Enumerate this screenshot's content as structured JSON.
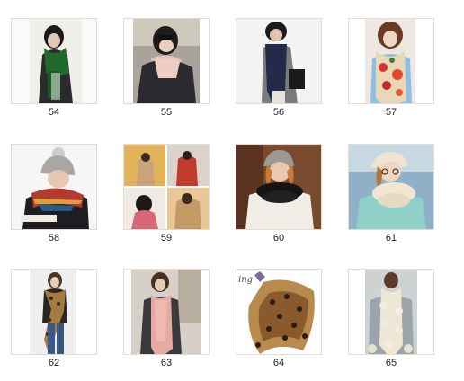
{
  "gallery": {
    "items": [
      {
        "number": "54",
        "image": "woman-green-scarf-photo"
      },
      {
        "number": "55",
        "image": "woman-pink-scarf-sunglasses-photo"
      },
      {
        "number": "56",
        "image": "woman-navy-scarf-photo"
      },
      {
        "number": "57",
        "image": "woman-floral-scarf-photo"
      },
      {
        "number": "58",
        "image": "woman-knit-hat-plaid-scarf-photo"
      },
      {
        "number": "59",
        "image": "scarf-collage-four-photos"
      },
      {
        "number": "60",
        "image": "woman-black-infinity-scarf-photo"
      },
      {
        "number": "61",
        "image": "woman-cream-knit-scarf-photo"
      },
      {
        "number": "62",
        "image": "woman-leopard-scarf-photo"
      },
      {
        "number": "63",
        "image": "woman-pink-long-scarf-photo"
      },
      {
        "number": "64",
        "image": "leopard-print-scarf-product-photo"
      },
      {
        "number": "65",
        "image": "woman-cream-fringe-scarf-photo"
      }
    ]
  }
}
